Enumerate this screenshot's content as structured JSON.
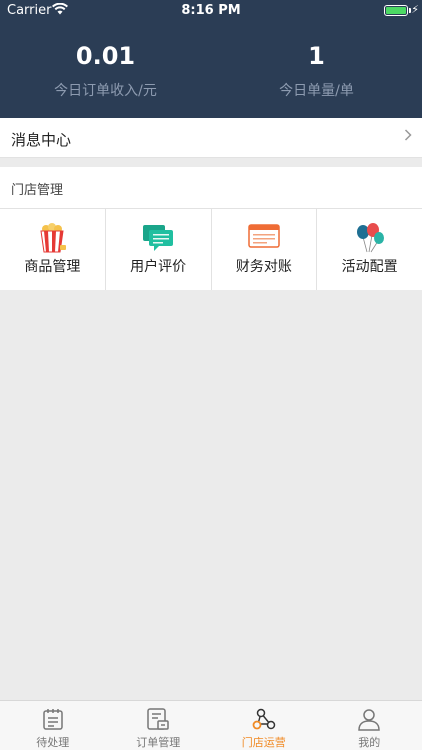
{
  "status_bar": {
    "carrier": "Carrier",
    "time": "8:16 PM"
  },
  "stats": [
    {
      "value": "0.01",
      "label": "今日订单收入/元"
    },
    {
      "value": "1",
      "label": "今日单量/单"
    }
  ],
  "message_center": {
    "label": "消息中心"
  },
  "store_section": {
    "title": "门店管理"
  },
  "store_items": [
    {
      "label": "商品管理",
      "icon": "popcorn-icon"
    },
    {
      "label": "用户评价",
      "icon": "chat-bubbles-icon"
    },
    {
      "label": "财务对账",
      "icon": "browser-window-icon"
    },
    {
      "label": "活动配置",
      "icon": "balloons-icon"
    }
  ],
  "tabs": [
    {
      "label": "待处理",
      "icon": "notepad-icon"
    },
    {
      "label": "订单管理",
      "icon": "order-list-icon"
    },
    {
      "label": "门店运营",
      "icon": "store-network-icon",
      "active": true
    },
    {
      "label": "我的",
      "icon": "person-icon"
    }
  ],
  "colors": {
    "header": "#2b3d55",
    "accent": "#f08a24",
    "background": "#ebebeb"
  }
}
